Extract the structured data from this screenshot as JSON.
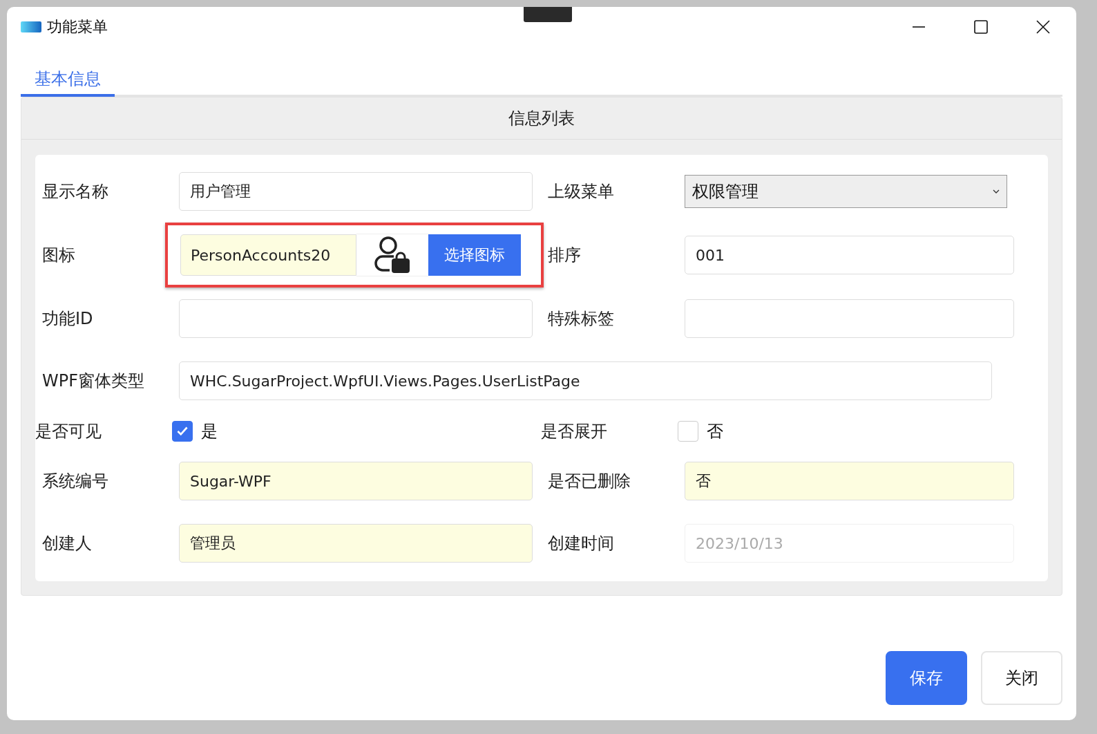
{
  "window": {
    "title": "功能菜单"
  },
  "tabs": [
    {
      "label": "基本信息",
      "selected": true
    }
  ],
  "section": {
    "title": "信息列表"
  },
  "rows": [
    {
      "fields": [
        {
          "kind": "text",
          "label": "显示名称",
          "value": "用户管理",
          "readonly": false
        },
        {
          "kind": "select",
          "label": "上级菜单",
          "value": "权限管理"
        }
      ]
    },
    {
      "fields": [
        {
          "kind": "icon-picker",
          "label": "图标",
          "value": "PersonAccounts20",
          "button": "选择图标",
          "readonly": true,
          "emphasized": true
        },
        {
          "kind": "text",
          "label": "排序",
          "value": "001",
          "readonly": false
        }
      ]
    },
    {
      "fields": [
        {
          "kind": "text",
          "label": "功能ID",
          "readonly": false
        },
        {
          "kind": "text",
          "label": "特殊标签",
          "readonly": false
        }
      ]
    },
    {
      "fields": [
        {
          "kind": "wide",
          "label": "WPF窗体类型",
          "value": "WHC.SugarProject.WpfUI.Views.Pages.UserListPage",
          "readonly": false
        }
      ]
    },
    {
      "fields": [
        {
          "kind": "checkbox",
          "label": "是否可见",
          "text": "是",
          "checked": true
        },
        {
          "kind": "checkbox",
          "label": "是否展开",
          "text": "否",
          "checked": false
        }
      ]
    },
    {
      "fields": [
        {
          "kind": "text",
          "label": "系统编号",
          "value": "Sugar-WPF",
          "readonly": true
        },
        {
          "kind": "text",
          "label": "是否已删除",
          "value": "否",
          "readonly": true
        }
      ]
    },
    {
      "fields": [
        {
          "kind": "text",
          "label": "创建人",
          "value": "管理员",
          "readonly": true
        },
        {
          "kind": "date",
          "label": "创建时间",
          "value": "2023/10/13",
          "disabled": true
        }
      ]
    }
  ],
  "buttons": [
    {
      "label": "保存",
      "primary": true
    },
    {
      "label": "关闭",
      "primary": false
    }
  ]
}
